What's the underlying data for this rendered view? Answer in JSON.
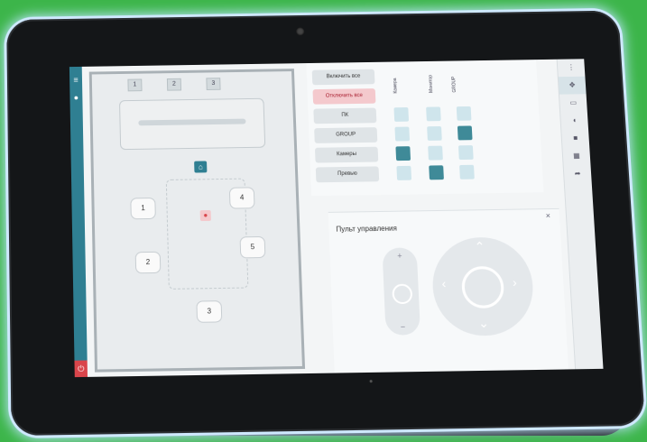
{
  "matrix": {
    "rows": [
      "Включить все",
      "Отключить все",
      "ПК",
      "GROUP",
      "Камеры",
      "Превью"
    ],
    "columns": [
      "Камера",
      "Монитор",
      "GROUP"
    ],
    "active": [
      [
        4,
        0
      ],
      [
        3,
        2
      ],
      [
        5,
        1
      ]
    ]
  },
  "floorplan": {
    "rooms": [
      "1",
      "2",
      "3"
    ],
    "cameras": [
      "1",
      "2",
      "3",
      "4",
      "5"
    ]
  },
  "remote": {
    "title": "Пульт управления",
    "close": "×",
    "plus": "+",
    "minus": "−"
  },
  "icons": {
    "menu": "menu-icon",
    "info": "info-icon",
    "power": "power-icon",
    "home": "home-icon",
    "mic": "microphone-icon"
  },
  "colors": {
    "accent": "#2f7f92",
    "danger": "#d9454b",
    "cell_on": "#3f8a98",
    "cell_off": "#cfe5ec"
  }
}
